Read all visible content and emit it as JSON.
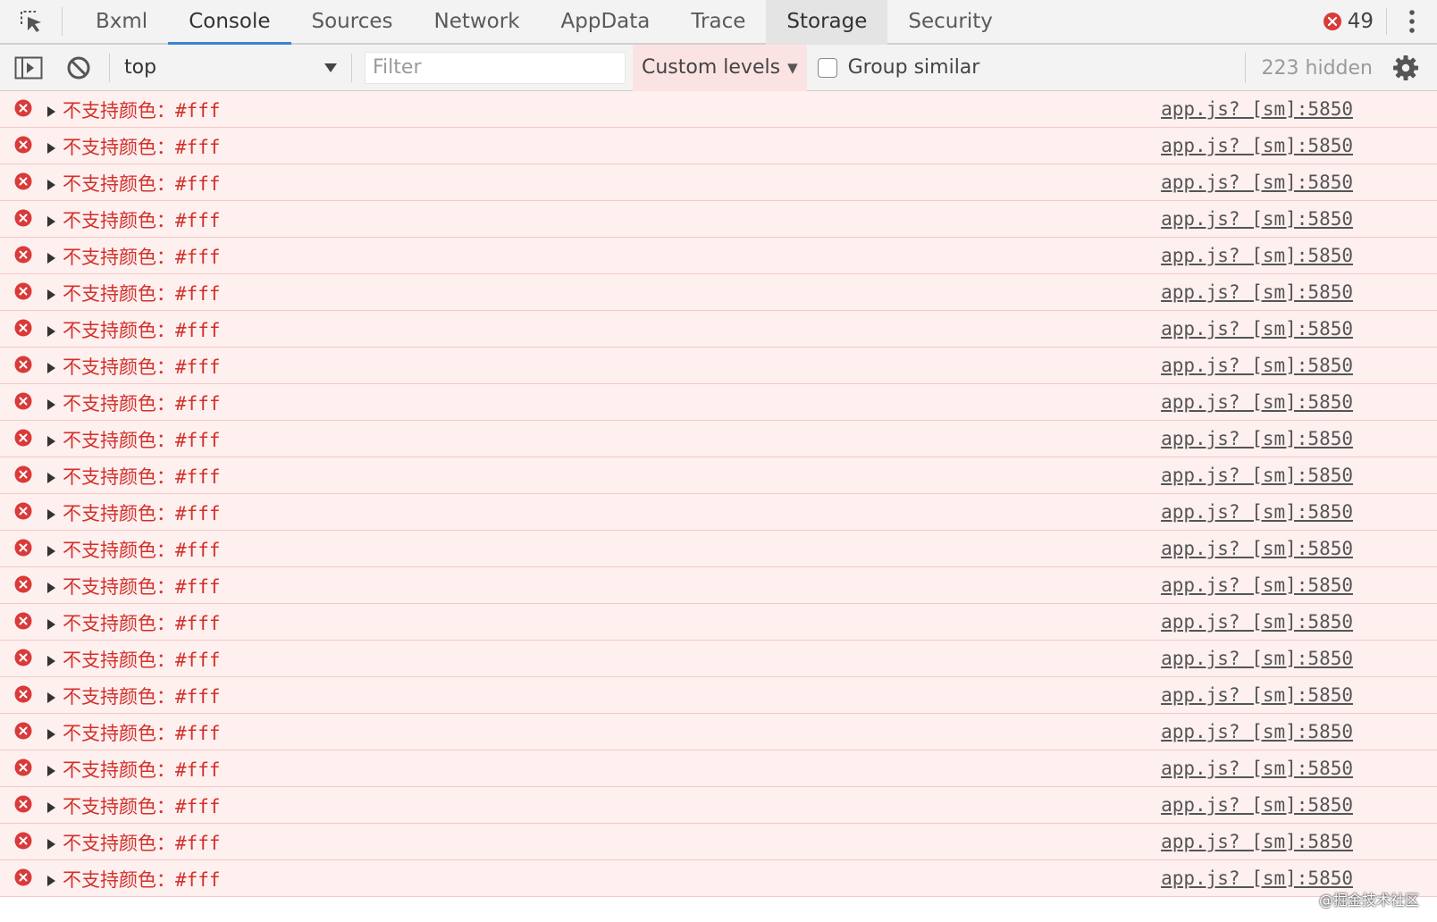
{
  "tabs": {
    "items": [
      {
        "label": "Bxml"
      },
      {
        "label": "Console"
      },
      {
        "label": "Sources"
      },
      {
        "label": "Network"
      },
      {
        "label": "AppData"
      },
      {
        "label": "Trace"
      },
      {
        "label": "Storage"
      },
      {
        "label": "Security"
      }
    ],
    "active": "Console",
    "hovered": "Storage",
    "error_count": "49"
  },
  "toolbar": {
    "context": "top",
    "filter_placeholder": "Filter",
    "levels": "Custom levels",
    "group_similar": "Group similar",
    "group_similar_checked": false,
    "hidden_count": "223 hidden"
  },
  "console": {
    "rows": [
      {
        "message": "不支持颜色：#fff",
        "source": "app.js? [sm]:5850"
      },
      {
        "message": "不支持颜色：#fff",
        "source": "app.js? [sm]:5850"
      },
      {
        "message": "不支持颜色：#fff",
        "source": "app.js? [sm]:5850"
      },
      {
        "message": "不支持颜色：#fff",
        "source": "app.js? [sm]:5850"
      },
      {
        "message": "不支持颜色：#fff",
        "source": "app.js? [sm]:5850"
      },
      {
        "message": "不支持颜色：#fff",
        "source": "app.js? [sm]:5850"
      },
      {
        "message": "不支持颜色：#fff",
        "source": "app.js? [sm]:5850"
      },
      {
        "message": "不支持颜色：#fff",
        "source": "app.js? [sm]:5850"
      },
      {
        "message": "不支持颜色：#fff",
        "source": "app.js? [sm]:5850"
      },
      {
        "message": "不支持颜色：#fff",
        "source": "app.js? [sm]:5850"
      },
      {
        "message": "不支持颜色：#fff",
        "source": "app.js? [sm]:5850"
      },
      {
        "message": "不支持颜色：#fff",
        "source": "app.js? [sm]:5850"
      },
      {
        "message": "不支持颜色：#fff",
        "source": "app.js? [sm]:5850"
      },
      {
        "message": "不支持颜色：#fff",
        "source": "app.js? [sm]:5850"
      },
      {
        "message": "不支持颜色：#fff",
        "source": "app.js? [sm]:5850"
      },
      {
        "message": "不支持颜色：#fff",
        "source": "app.js? [sm]:5850"
      },
      {
        "message": "不支持颜色：#fff",
        "source": "app.js? [sm]:5850"
      },
      {
        "message": "不支持颜色：#fff",
        "source": "app.js? [sm]:5850"
      },
      {
        "message": "不支持颜色：#fff",
        "source": "app.js? [sm]:5850"
      },
      {
        "message": "不支持颜色：#fff",
        "source": "app.js? [sm]:5850"
      },
      {
        "message": "不支持颜色：#fff",
        "source": "app.js? [sm]:5850"
      },
      {
        "message": "不支持颜色：#fff",
        "source": "app.js? [sm]:5850"
      }
    ]
  },
  "watermark": "@掘金技术社区",
  "colors": {
    "accent": "#3b82d6",
    "error_text": "#d3302a",
    "error_row_bg": "#fdf0ef",
    "error_row_border": "#f6c8c6",
    "error_icon": "#d93a3a"
  },
  "icons": {
    "inspect": "element-picker-icon",
    "sidebar": "sidebar-toggle-icon",
    "clear": "clear-console-icon",
    "error": "error-circle-icon",
    "expand": "expand-triangle-icon",
    "settings": "gear-icon",
    "more": "kebab-menu-icon"
  }
}
